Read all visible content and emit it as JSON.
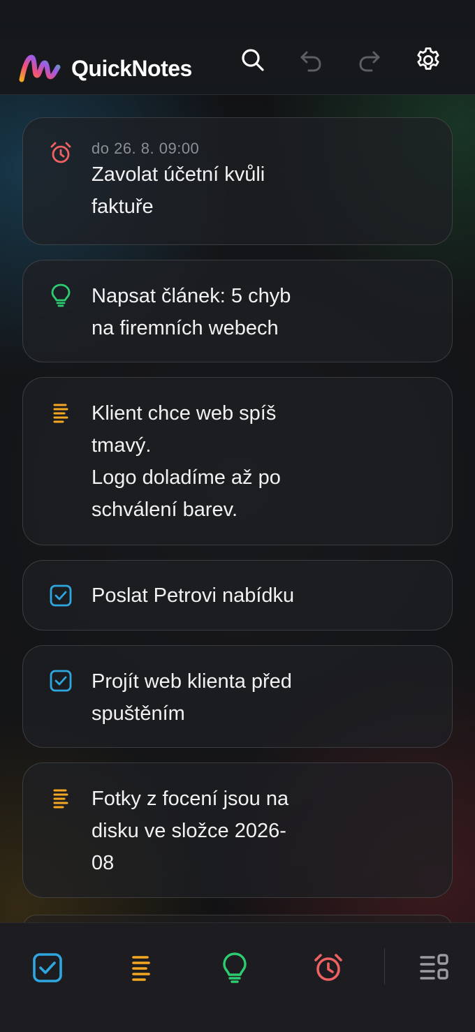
{
  "app": {
    "title": "QuickNotes"
  },
  "colors": {
    "task": "#2ea7e0",
    "note": "#f5a623",
    "idea": "#2ecc71",
    "reminder": "#f06262",
    "muted": "#8c8f95"
  },
  "header": {
    "icons": [
      "search-icon",
      "undo-icon",
      "redo-icon",
      "settings-icon"
    ]
  },
  "notes": [
    {
      "type": "reminder",
      "icon": "alarm-clock-icon",
      "meta": "do 26. 8. 09:00",
      "text": "Zavolat účetní kvůli\nfaktuře"
    },
    {
      "type": "idea",
      "icon": "lightbulb-icon",
      "meta": "",
      "text": "Napsat článek: 5 chyb\nna firemních webech"
    },
    {
      "type": "note",
      "icon": "text-lines-icon",
      "meta": "",
      "text": "Klient chce web spíš\ntmavý.\nLogo doladíme až po\nschválení barev."
    },
    {
      "type": "task",
      "icon": "checkbox-icon",
      "meta": "",
      "text": "Poslat Petrovi nabídku"
    },
    {
      "type": "task",
      "icon": "checkbox-icon",
      "meta": "",
      "text": "Projít web klienta před\nspuštěním"
    },
    {
      "type": "note",
      "icon": "text-lines-icon",
      "meta": "",
      "text": "Fotky z focení jsou na\ndisku ve složce 2026-\n08"
    }
  ],
  "bottom_bar": {
    "items": [
      "add-task-icon",
      "add-note-icon",
      "add-idea-icon",
      "add-reminder-icon",
      "filter-icon"
    ]
  }
}
